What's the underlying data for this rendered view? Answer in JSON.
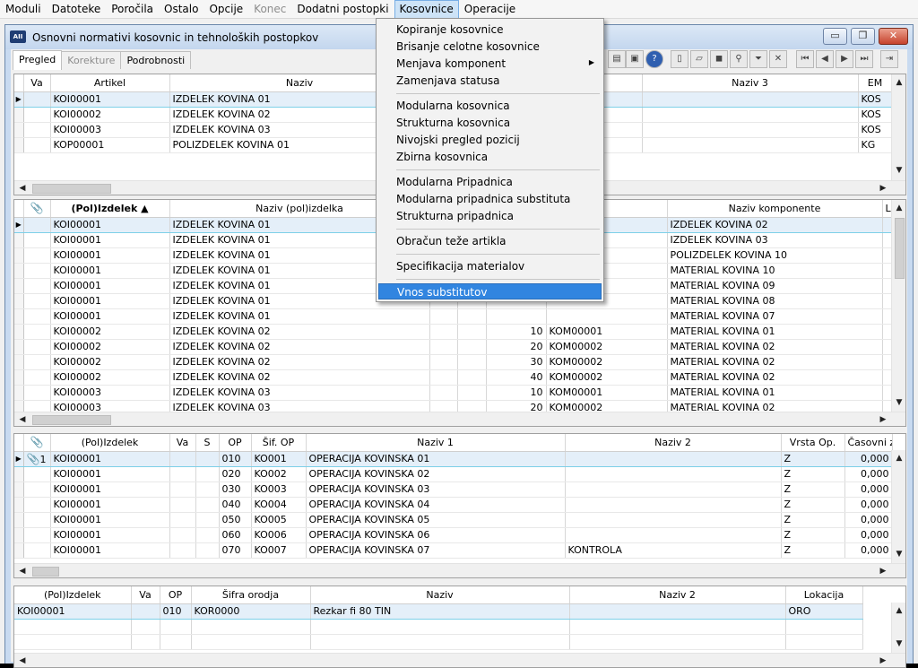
{
  "menubar": {
    "items": [
      {
        "label": "Moduli",
        "state": "normal"
      },
      {
        "label": "Datoteke",
        "state": "normal"
      },
      {
        "label": "Poročila",
        "state": "normal"
      },
      {
        "label": "Ostalo",
        "state": "normal"
      },
      {
        "label": "Opcije",
        "state": "normal"
      },
      {
        "label": "Konec",
        "state": "disabled"
      },
      {
        "label": "Dodatni postopki",
        "state": "normal"
      },
      {
        "label": "Kosovnice",
        "state": "active"
      },
      {
        "label": "Operacije",
        "state": "normal"
      }
    ]
  },
  "window": {
    "title": "Osnovni normativi kosovnic in tehnoloških postopkov",
    "icon_text": "AII",
    "buttons": {
      "minimize": "▭",
      "maximize": "❐",
      "close": "✕"
    }
  },
  "tabs": [
    {
      "label": "Pregled",
      "state": "active"
    },
    {
      "label": "Korekture",
      "state": "disabled"
    },
    {
      "label": "Podrobnosti",
      "state": "normal"
    }
  ],
  "kosovnice_menu": {
    "groups": [
      [
        {
          "label": "Kopiranje kosovnice"
        },
        {
          "label": "Brisanje celotne kosovnice"
        },
        {
          "label": "Menjava komponent",
          "arrow": "▶"
        },
        {
          "label": "Zamenjava statusa"
        }
      ],
      [
        {
          "label": "Modularna kosovnica"
        },
        {
          "label": "Strukturna kosovnica"
        },
        {
          "label": "Nivojski pregled pozicij"
        },
        {
          "label": "Zbirna kosovnica"
        }
      ],
      [
        {
          "label": "Modularna Pripadnica"
        },
        {
          "label": "Modularna pripadnica substituta"
        },
        {
          "label": "Strukturna pripadnica"
        }
      ],
      [
        {
          "label": "Obračun teže artikla"
        }
      ],
      [
        {
          "label": "Specifikacija materialov"
        }
      ],
      [
        {
          "label": "Vnos substitutov",
          "highlighted": true
        }
      ]
    ]
  },
  "grid1": {
    "headers": [
      "Va",
      "Artikel",
      "Naziv",
      "",
      "Naziv 3",
      "EM"
    ],
    "rows": [
      [
        "",
        "KOI00001",
        "IZDELEK KOVINA 01",
        "",
        "",
        "KOS"
      ],
      [
        "",
        "KOI00002",
        "IZDELEK KOVINA 02",
        "",
        "",
        "KOS"
      ],
      [
        "",
        "KOI00003",
        "IZDELEK KOVINA 03",
        "",
        "",
        "KOS"
      ],
      [
        "",
        "KOP00001",
        "POLIZDELEK KOVINA 01",
        "",
        "",
        "KG"
      ]
    ]
  },
  "grid2": {
    "headers": [
      "(Pol)Izdelek ▲",
      "Naziv (pol)izdelka",
      "",
      "",
      "",
      "",
      "Naziv komponente",
      "Lokacija"
    ],
    "rows": [
      [
        "KOI00001",
        "IZDELEK KOVINA 01",
        "",
        "",
        "",
        "",
        "IZDELEK KOVINA 02",
        ""
      ],
      [
        "KOI00001",
        "IZDELEK KOVINA 01",
        "",
        "",
        "",
        "",
        "IZDELEK KOVINA 03",
        ""
      ],
      [
        "KOI00001",
        "IZDELEK KOVINA 01",
        "",
        "",
        "",
        "",
        "POLIZDELEK KOVINA 10",
        ""
      ],
      [
        "KOI00001",
        "IZDELEK KOVINA 01",
        "",
        "",
        "",
        "",
        "MATERIAL KOVINA 10",
        ""
      ],
      [
        "KOI00001",
        "IZDELEK KOVINA 01",
        "",
        "",
        "",
        "",
        "MATERIAL KOVINA 09",
        ""
      ],
      [
        "KOI00001",
        "IZDELEK KOVINA 01",
        "",
        "",
        "",
        "",
        "MATERIAL KOVINA 08",
        ""
      ],
      [
        "KOI00001",
        "IZDELEK KOVINA 01",
        "",
        "",
        "",
        "",
        "MATERIAL KOVINA 07",
        ""
      ],
      [
        "KOI00002",
        "IZDELEK KOVINA 02",
        "",
        "",
        "10",
        "KOM00001",
        "MATERIAL KOVINA 01",
        ""
      ],
      [
        "KOI00002",
        "IZDELEK KOVINA 02",
        "",
        "",
        "20",
        "KOM00002",
        "MATERIAL KOVINA 02",
        ""
      ],
      [
        "KOI00002",
        "IZDELEK KOVINA 02",
        "",
        "",
        "30",
        "KOM00002",
        "MATERIAL KOVINA 02",
        ""
      ],
      [
        "KOI00002",
        "IZDELEK KOVINA 02",
        "",
        "",
        "40",
        "KOM00002",
        "MATERIAL KOVINA 02",
        ""
      ],
      [
        "KOI00003",
        "IZDELEK KOVINA 03",
        "",
        "",
        "10",
        "KOM00001",
        "MATERIAL KOVINA 01",
        ""
      ],
      [
        "KOI00003",
        "IZDELEK KOVINA 03",
        "",
        "",
        "20",
        "KOM00002",
        "MATERIAL KOVINA 02",
        ""
      ]
    ]
  },
  "grid3": {
    "headers": [
      "(Pol)Izdelek",
      "Va",
      "S",
      "OP",
      "Šif. OP",
      "Naziv 1",
      "Naziv 2",
      "Vrsta Op.",
      "Časovni z"
    ],
    "first_row_marker": "1",
    "rows": [
      [
        "KOI00001",
        "",
        "",
        "010",
        "KO001",
        "OPERACIJA KOVINSKA 01",
        "",
        "Z",
        "0,000"
      ],
      [
        "KOI00001",
        "",
        "",
        "020",
        "KO002",
        "OPERACIJA KOVINSKA 02",
        "",
        "Z",
        "0,000"
      ],
      [
        "KOI00001",
        "",
        "",
        "030",
        "KO003",
        "OPERACIJA KOVINSKA 03",
        "",
        "Z",
        "0,000"
      ],
      [
        "KOI00001",
        "",
        "",
        "040",
        "KO004",
        "OPERACIJA KOVINSKA 04",
        "",
        "Z",
        "0,000"
      ],
      [
        "KOI00001",
        "",
        "",
        "050",
        "KO005",
        "OPERACIJA KOVINSKA 05",
        "",
        "Z",
        "0,000"
      ],
      [
        "KOI00001",
        "",
        "",
        "060",
        "KO006",
        "OPERACIJA KOVINSKA 06",
        "",
        "Z",
        "0,000"
      ],
      [
        "KOI00001",
        "",
        "",
        "070",
        "KO007",
        "OPERACIJA KOVINSKA 07",
        "KONTROLA",
        "Z",
        "0,000"
      ]
    ]
  },
  "grid4": {
    "headers": [
      "(Pol)Izdelek",
      "Va",
      "OP",
      "Šifra orodja",
      "Naziv",
      "Naziv 2",
      "Lokacija"
    ],
    "rows": [
      [
        "KOI00001",
        "",
        "010",
        "KOR0000",
        "Rezkar fi 80 TIN",
        "",
        "ORO"
      ],
      [
        "",
        "",
        "",
        "",
        "",
        "",
        ""
      ],
      [
        "",
        "",
        "",
        "",
        "",
        "",
        ""
      ]
    ]
  },
  "icons": {
    "row_pointer": "▶",
    "paperclip": "📎",
    "arrow_left": "◀",
    "arrow_right": "▶",
    "arrow_up": "▲",
    "arrow_down": "▼",
    "toolbar": [
      "folder",
      "screen",
      "help",
      "doc",
      "open",
      "save",
      "search",
      "filter",
      "clear",
      "first",
      "prev",
      "next",
      "last",
      "exit"
    ]
  },
  "colors": {
    "selection_row": "#e4eff9",
    "menu_highlight": "#3185e0",
    "close_button": "#c6422c"
  }
}
